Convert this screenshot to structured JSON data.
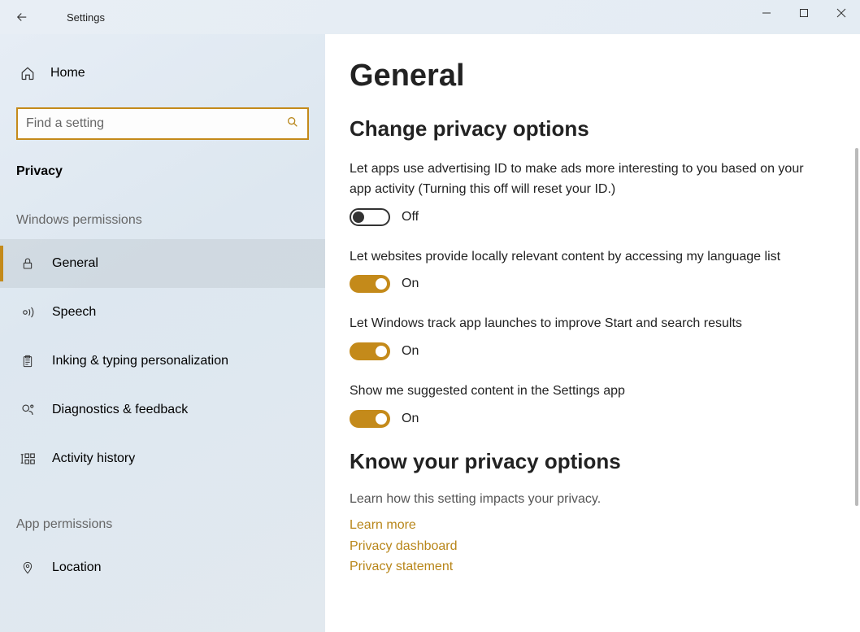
{
  "window": {
    "title": "Settings"
  },
  "sidebar": {
    "home": "Home",
    "search_placeholder": "Find a setting",
    "section": "Privacy",
    "group1": "Windows permissions",
    "items1": [
      {
        "label": "General",
        "icon": "lock"
      },
      {
        "label": "Speech",
        "icon": "speech"
      },
      {
        "label": "Inking & typing personalization",
        "icon": "clipboard"
      },
      {
        "label": "Diagnostics & feedback",
        "icon": "feedback"
      },
      {
        "label": "Activity history",
        "icon": "history"
      }
    ],
    "group2": "App permissions",
    "items2": [
      {
        "label": "Location",
        "icon": "location"
      }
    ]
  },
  "main": {
    "heading": "General",
    "section1": "Change privacy options",
    "opts": [
      {
        "desc": "Let apps use advertising ID to make ads more interesting to you based on your app activity (Turning this off will reset your ID.)",
        "state": "Off",
        "on": false
      },
      {
        "desc": "Let websites provide locally relevant content by accessing my language list",
        "state": "On",
        "on": true
      },
      {
        "desc": "Let Windows track app launches to improve Start and search results",
        "state": "On",
        "on": true
      },
      {
        "desc": "Show me suggested content in the Settings app",
        "state": "On",
        "on": true
      }
    ],
    "section2": "Know your privacy options",
    "info": "Learn how this setting impacts your privacy.",
    "links": [
      "Learn more",
      "Privacy dashboard",
      "Privacy statement"
    ]
  }
}
